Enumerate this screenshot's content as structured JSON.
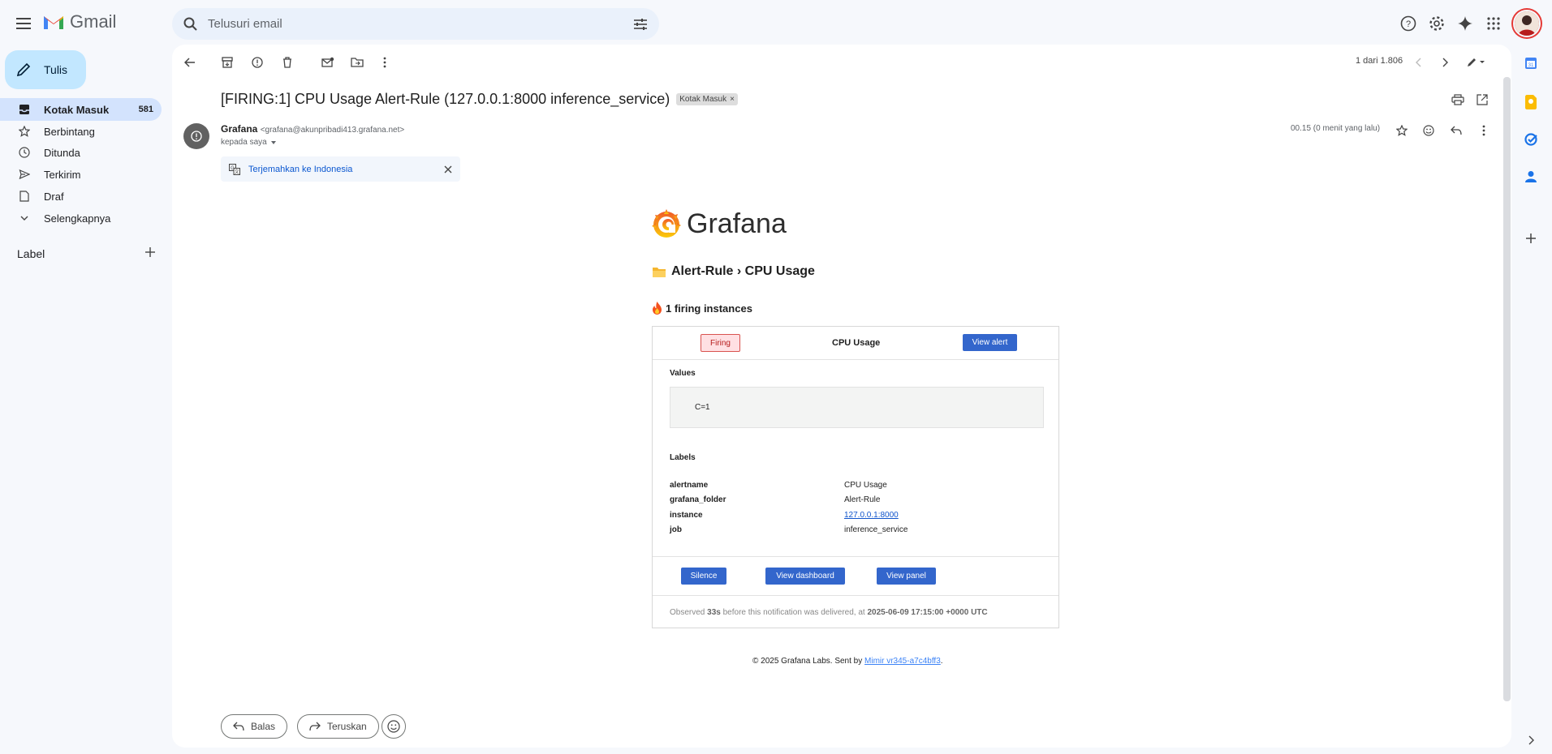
{
  "app": {
    "name": "Gmail"
  },
  "search": {
    "placeholder": "Telusuri email"
  },
  "sidebar": {
    "compose_label": "Tulis",
    "items": [
      {
        "label": "Kotak Masuk",
        "count": "581",
        "icon": "inbox-icon",
        "active": true
      },
      {
        "label": "Berbintang",
        "icon": "star-icon"
      },
      {
        "label": "Ditunda",
        "icon": "clock-icon"
      },
      {
        "label": "Terkirim",
        "icon": "send-icon"
      },
      {
        "label": "Draf",
        "icon": "draft-icon"
      },
      {
        "label": "Selengkapnya",
        "icon": "chevron-down-icon"
      }
    ],
    "labels_title": "Label"
  },
  "toolbar": {
    "pager": "1 dari 1.806"
  },
  "message": {
    "subject": "[FIRING:1] CPU Usage Alert-Rule (127.0.0.1:8000 inference_service)",
    "chip": "Kotak Masuk",
    "sender_name": "Grafana",
    "sender_email": "<grafana@akunpribadi413.grafana.net>",
    "to": "kepada saya",
    "time": "00.15 (0 menit yang lalu)",
    "translate": "Terjemahkan ke Indonesia"
  },
  "email": {
    "logo_text": "Grafana",
    "breadcrumb": "Alert-Rule › CPU Usage",
    "firing_count": "1 firing instances",
    "status_badge": "Firing",
    "alert_name": "CPU Usage",
    "view_alert": "View alert",
    "values_title": "Values",
    "values": "C=1",
    "labels_title": "Labels",
    "labels": [
      {
        "key": "alertname",
        "value": "CPU Usage"
      },
      {
        "key": "grafana_folder",
        "value": "Alert-Rule"
      },
      {
        "key": "instance",
        "value": "127.0.0.1:8000"
      },
      {
        "key": "job",
        "value": "inference_service"
      }
    ],
    "buttons": {
      "silence": "Silence",
      "dashboard": "View dashboard",
      "panel": "View panel"
    },
    "observed_prefix": "Observed ",
    "observed_duration": "33s",
    "observed_mid": " before this notification was delivered, at ",
    "observed_time": "2025-06-09 17:15:00 +0000 UTC",
    "footer_text": "© 2025 Grafana Labs. Sent by ",
    "footer_link": "Mimir vr345-a7c4bff3",
    "footer_end": "."
  },
  "reply": {
    "reply_label": "Balas",
    "forward_label": "Teruskan"
  },
  "colors": {
    "accent": "#0b57d0",
    "compose_bg": "#c2e7ff",
    "active_nav": "#d3e3fd",
    "grafana_blue": "#3366cc",
    "firing_red": "#d9534f"
  }
}
